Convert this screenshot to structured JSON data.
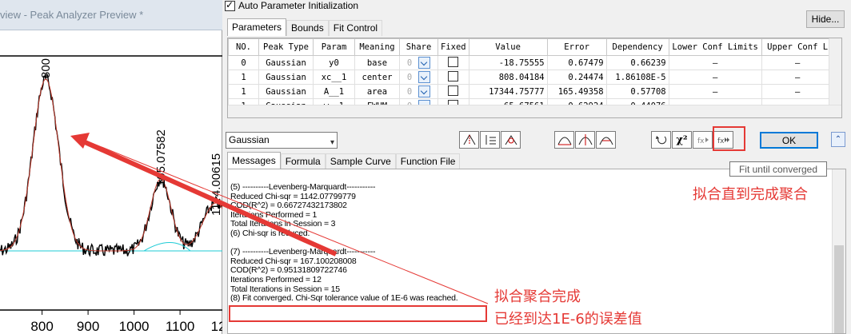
{
  "preview": {
    "title": "view - Peak Analyzer Preview *",
    "x_ticks": [
      "800",
      "900",
      "1000",
      "1100",
      "1200"
    ],
    "peak_labels": [
      "800",
      "105.07582",
      "1174.00615"
    ]
  },
  "dialog": {
    "auto_init_label": "Auto Parameter Initialization",
    "auto_init_checked": true,
    "hide_label": "Hide...",
    "top_tabs": [
      "Parameters",
      "Bounds",
      "Fit Control"
    ],
    "table": {
      "headers": [
        "NO.",
        "Peak Type",
        "Param",
        "Meaning",
        "Share",
        "Fixed",
        "Value",
        "Error",
        "Dependency",
        "Lower Conf Limits",
        "Upper Conf L"
      ],
      "rows": [
        {
          "no": "0",
          "type": "Gaussian",
          "param": "y0",
          "meaning": "base",
          "share": "0",
          "value": "-18.75555",
          "error": "0.67479",
          "dependency": "0.66239",
          "lower": "—",
          "upper": "—"
        },
        {
          "no": "1",
          "type": "Gaussian",
          "param": "xc__1",
          "meaning": "center",
          "share": "0",
          "value": "808.04184",
          "error": "0.24474",
          "dependency": "1.86108E-5",
          "lower": "—",
          "upper": "—"
        },
        {
          "no": "1",
          "type": "Gaussian",
          "param": "A__1",
          "meaning": "area",
          "share": "0",
          "value": "17344.75777",
          "error": "165.49358",
          "dependency": "0.57708",
          "lower": "—",
          "upper": "—"
        },
        {
          "no": "1",
          "type": "Gaussian",
          "param": "w__1",
          "meaning": "FWHM",
          "share": "0",
          "value": "65.67561",
          "error": "0.62924",
          "dependency": "0.44076",
          "lower": "—",
          "upper": "—"
        }
      ]
    },
    "function_select": "Gaussian",
    "ok_label": "OK",
    "tooltip": "Fit until converged",
    "bottom_tabs": [
      "Messages",
      "Formula",
      "Sample Curve",
      "Function File"
    ],
    "messages": [
      "(5) ----------Levenberg-Marquardt-----------",
      "Reduced Chi-sqr = 1142.07799779",
      "COD(R^2) = 0.66727432173802",
      "Iterations Performed = 1",
      "Total Iterations in Session = 3",
      "(6) Chi-sqr is reduced.",
      "",
      "(7) ----------Levenberg-Marquardt-----------",
      "Reduced Chi-sqr = 167.100208008",
      "COD(R^2) = 0.95131809722746",
      "Iterations Performed = 12",
      "Total Iterations in Session = 15",
      "(8) Fit converged. Chi-Sqr tolerance value of 1E-6 was reached."
    ]
  },
  "annotations": {
    "fit_until_converged_cn": "拟合直到完成聚合",
    "converged_cn_line1": "拟合聚合完成",
    "converged_cn_line2": "已经到达1E-6的误差值"
  },
  "colors": {
    "annotation_red": "#e53935",
    "fit_curve": "#c0392b",
    "baseline": "#1ecbd6"
  }
}
